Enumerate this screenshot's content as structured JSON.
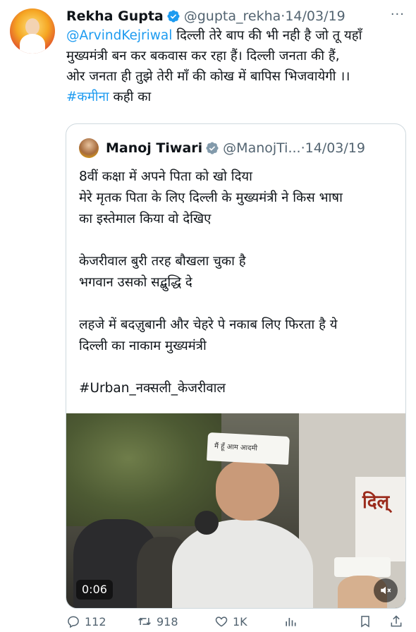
{
  "tweet": {
    "author": {
      "name": "Rekha Gupta",
      "handle": "@gupta_rekha",
      "separator": "·",
      "date": "14/03/19"
    },
    "more_label": "···",
    "text": {
      "mention": "@ArvindKejriwal",
      "line1_rest": " दिल्ली तेरे बाप की भी नही है जो तू यहाँ",
      "line2": "मुख्यमंत्री बन कर बकवास कर रहा हैं। दिल्ली जनता की हैं,",
      "line3": "ओर जनता ही तुझे तेरी माँ की कोख में बापिस भिजवायेगी ।।",
      "hashtag": "#कमीना",
      "line4_rest": " कही का"
    },
    "quote": {
      "author": {
        "name": "Manoj Tiwari",
        "handle": "@ManojTi...",
        "separator": "·",
        "date": "14/03/19"
      },
      "lines": [
        "8वीं कक्षा में अपने पिता को खो दिया",
        "मेरे मृतक पिता के लिए दिल्ली के मुख्यमंत्री ने किस भाषा",
        "का इस्तेमाल किया वो देखिए",
        "",
        "केजरीवाल बुरी तरह बौखला चुका है",
        "भगवान उसको सद्बुद्धि दे",
        "",
        "लहजे में बदज़ुबानी और चेहरे पे नकाब लिए फिरता है ये",
        "दिल्ली का नाकाम मुख्यमंत्री",
        "",
        "#Urban_नक्सली_केजरीवाल"
      ],
      "media": {
        "duration": "0:06",
        "cap_text": "मैं हूँ आम आदमी",
        "banner_text": "दिल्"
      }
    },
    "actions": {
      "replies": "112",
      "retweets": "918",
      "likes": "1K"
    },
    "colors": {
      "link": "#1d9bf0",
      "text": "#0f1419",
      "muted": "#536471",
      "border": "#cfd9de"
    }
  }
}
